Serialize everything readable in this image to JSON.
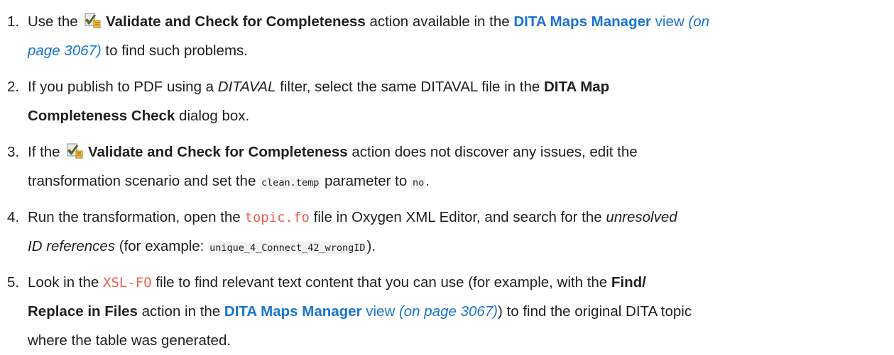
{
  "steps": [
    {
      "num": "1.",
      "l1_t1": "Use the ",
      "l1_ui": "Validate and Check for Completeness",
      "l1_t2": " action available in the ",
      "l1_link": "DITA Maps Manager",
      "l1_t3": " view ",
      "l1_xref1": "(on",
      "l2_xref2": "page 3067)",
      "l2_t4": " to find such problems."
    },
    {
      "num": "2.",
      "l1_t1": "If you publish to PDF using a ",
      "l1_em": "DITAVAL",
      "l1_t2": " filter, select the same DITAVAL file in the ",
      "l1_ui": "DITA Map",
      "l2_ui": "Completeness Check",
      "l2_t3": " dialog box."
    },
    {
      "num": "3.",
      "l1_t1": "If the ",
      "l1_ui": "Validate and Check for Completeness",
      "l1_t2": " action does not discover any issues, edit the",
      "l2_t3": "transformation scenario and set the ",
      "l2_code1": "clean.temp",
      "l2_t4": " parameter to ",
      "l2_code2": "no",
      "l2_t5": "."
    },
    {
      "num": "4.",
      "l1_t1": "Run the transformation, open the ",
      "l1_file": "topic.fo",
      "l1_t2": " file in Oxygen XML Editor, and search for the ",
      "l1_em": "unresolved",
      "l2_em": "ID references",
      "l2_t3": " (for example: ",
      "l2_code": "unique_4_Connect_42_wrongID",
      "l2_t4": ")."
    },
    {
      "num": "5.",
      "l1_t1": "Look in the ",
      "l1_file": "XSL-FO",
      "l1_t2": " file to find relevant text content that you can use (for example, with the ",
      "l1_ui": "Find/",
      "l2_ui": "Replace in Files",
      "l2_t3": " action in the ",
      "l2_link": "DITA Maps Manager",
      "l2_t4": " view ",
      "l2_xref": "(on page 3067)",
      "l2_t5": ") to find the original DITA topic",
      "l3_t6": "where the table was generated."
    }
  ],
  "icons": {
    "validate_icon": "validate-check-completeness-icon",
    "colors": {
      "check": "#3a7d1a",
      "cross": "#d03a2a",
      "page": "#e9edf3",
      "link": "#1874cd",
      "file": "#e8614f"
    }
  }
}
